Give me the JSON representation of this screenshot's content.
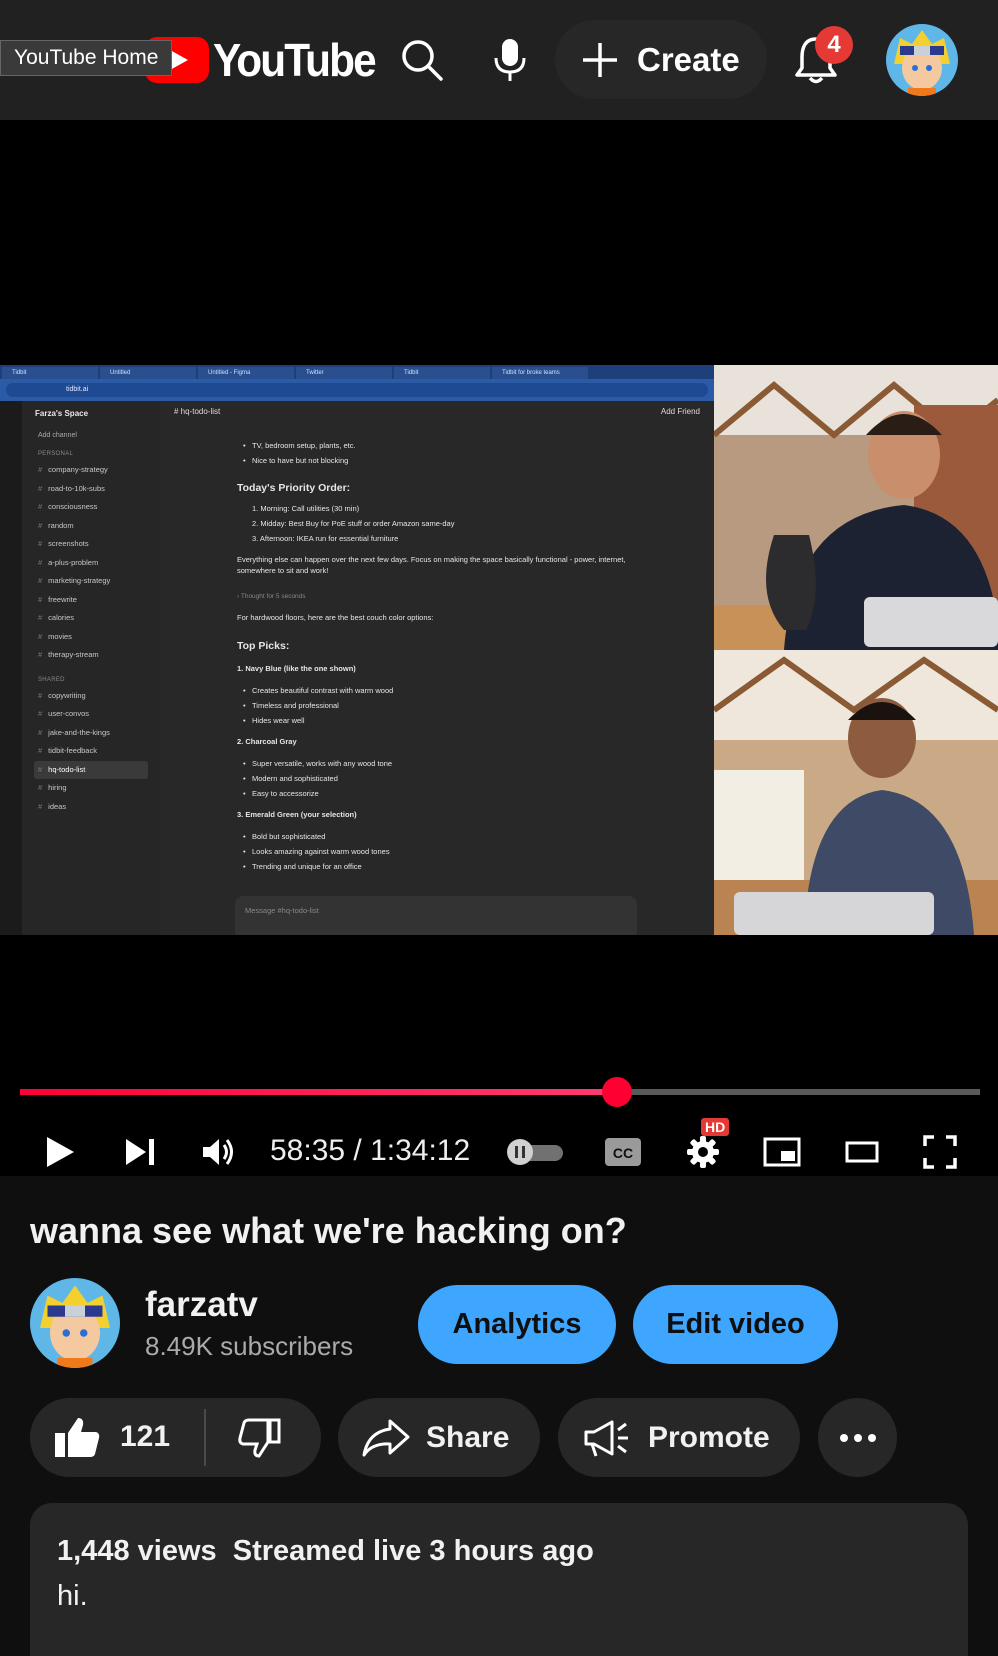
{
  "header": {
    "home_tooltip": "YouTube Home",
    "logo_text": "YouTube",
    "create_label": "Create",
    "notification_count": "4"
  },
  "video_frame": {
    "tabs": [
      "Tidbit",
      "Untitled",
      "Untitled - Figma",
      "Twitter",
      "Tidbit",
      "Tidbit for broke teams"
    ],
    "url": "tidbit.ai",
    "space_name": "Farza's Space",
    "add_channel": "Add channel",
    "personal_label": "PERSONAL",
    "personal_channels": [
      "company-strategy",
      "road-to-10k-subs",
      "consciousness",
      "random",
      "screenshots",
      "a-plus-problem",
      "marketing-strategy",
      "freewrite",
      "calories",
      "movies",
      "therapy-stream"
    ],
    "shared_label": "SHARED",
    "shared_channels": [
      "copywriting",
      "user-convos",
      "jake-and-the-kings",
      "tidbit-feedback",
      "hq-todo-list",
      "hiring",
      "ideas"
    ],
    "active_channel": "hq-todo-list",
    "chat_channel": "# hq-todo-list",
    "add_friend": "Add Friend",
    "lines": {
      "l1": "TV, bedroom setup, plants, etc.",
      "l2": "Nice to have but not blocking",
      "l3": "Today's Priority Order:",
      "l4": "1.  Morning: Call utilities (30 min)",
      "l5": "2.  Midday: Best Buy for PoE stuff or order Amazon same-day",
      "l6": "3.  Afternoon: IKEA run for essential furniture",
      "l7": "Everything else can happen over the next few days. Focus on making the space basically functional - power, internet, somewhere to sit and work!",
      "l8": "›  Thought for 5 seconds",
      "l9": "For hardwood floors, here are the best couch color options:",
      "l10": "Top Picks:",
      "l11": "1. Navy Blue (like the one shown)",
      "l12": "Creates beautiful contrast with warm wood",
      "l13": "Timeless and professional",
      "l14": "Hides wear well",
      "l15": "2. Charcoal Gray",
      "l16": "Super versatile, works with any wood tone",
      "l17": "Modern and sophisticated",
      "l18": "Easy to accessorize",
      "l19": "3. Emerald Green (your selection)",
      "l20": "Bold but sophisticated",
      "l21": "Looks amazing against warm wood tones",
      "l22": "Trending and unique for an office"
    },
    "message_placeholder": "Message #hq-todo-list"
  },
  "player": {
    "progress": 0.6214,
    "time": "58:35 / 1:34:12",
    "hd_label": "HD",
    "colors": {
      "progress": "#ff0033",
      "track": "#5a5a5a"
    }
  },
  "video": {
    "title": "wanna see what we're hacking on?",
    "channel_name": "farzatv",
    "subscribers": "8.49K subscribers",
    "analytics_label": "Analytics",
    "edit_label": "Edit video",
    "like_count": "121",
    "share_label": "Share",
    "promote_label": "Promote",
    "views": "1,448 views",
    "streamed": "Streamed live 3 hours ago",
    "description": "hi."
  },
  "colors": {
    "accent": "#3ea6ff",
    "brand": "#ff0000",
    "badge": "#e53935"
  }
}
